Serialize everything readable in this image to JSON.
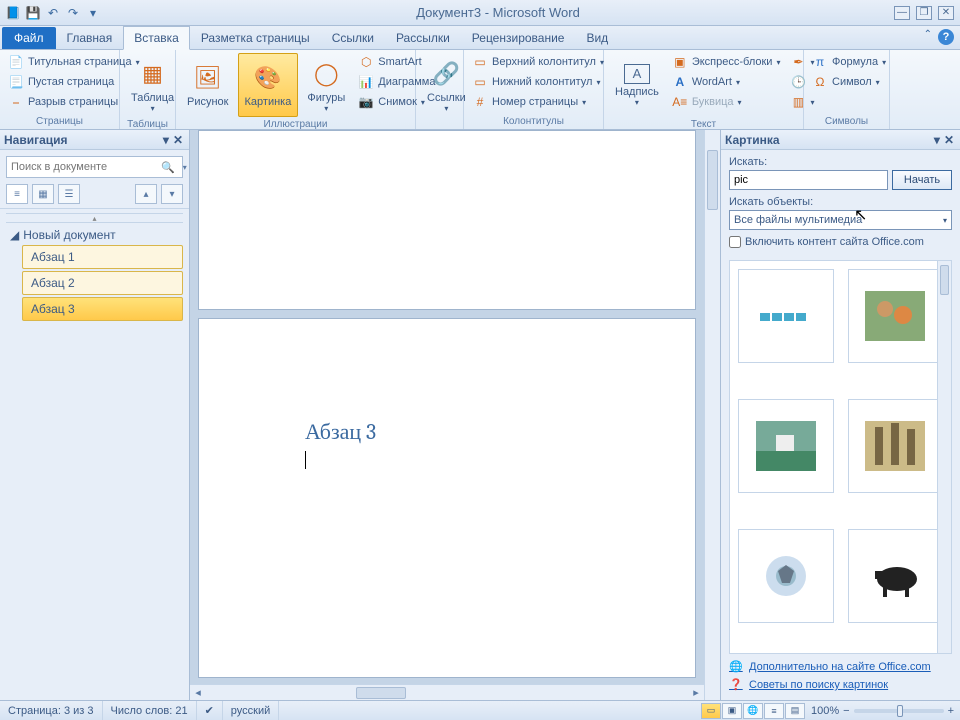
{
  "title": "Документ3  -  Microsoft Word",
  "tabs": {
    "file": "Файл",
    "home": "Главная",
    "insert": "Вставка",
    "layout": "Разметка страницы",
    "refs": "Ссылки",
    "mail": "Рассылки",
    "review": "Рецензирование",
    "view": "Вид"
  },
  "ribbon": {
    "pages": {
      "cover": "Титульная страница",
      "blank": "Пустая страница",
      "break": "Разрыв страницы",
      "label": "Страницы"
    },
    "tables": {
      "table": "Таблица",
      "label": "Таблицы"
    },
    "illus": {
      "picture": "Рисунок",
      "clipart": "Картинка",
      "shapes": "Фигуры",
      "smartart": "SmartArt",
      "chart": "Диаграмма",
      "screenshot": "Снимок",
      "label": "Иллюстрации"
    },
    "links": {
      "links": "Ссылки",
      "label": ""
    },
    "hf": {
      "header": "Верхний колонтитул",
      "footer": "Нижний колонтитул",
      "pagenum": "Номер страницы",
      "label": "Колонтитулы"
    },
    "text": {
      "textbox": "Надпись",
      "quickparts": "Экспресс-блоки",
      "wordart": "WordArt",
      "dropcap": "Буквица",
      "label": "Текст"
    },
    "symbols": {
      "equation": "Формула",
      "symbol": "Символ",
      "label": "Символы"
    }
  },
  "nav": {
    "title": "Навигация",
    "search_ph": "Поиск в документе",
    "root": "Новый документ",
    "items": [
      "Абзац 1",
      "Абзац 2",
      "Абзац 3"
    ]
  },
  "doc": {
    "heading": "Абзац 3"
  },
  "clip": {
    "title": "Картинка",
    "search_label": "Искать:",
    "search_value": "pic",
    "go": "Начать",
    "objects_label": "Искать объекты:",
    "objects_value": "Все файлы мультимедиа",
    "include_office": "Включить контент сайта Office.com",
    "link_more": "Дополнительно на сайте Office.com",
    "link_tips": "Советы по поиску картинок"
  },
  "status": {
    "page": "Страница: 3 из 3",
    "words": "Число слов: 21",
    "lang": "русский",
    "zoom": "100%"
  }
}
